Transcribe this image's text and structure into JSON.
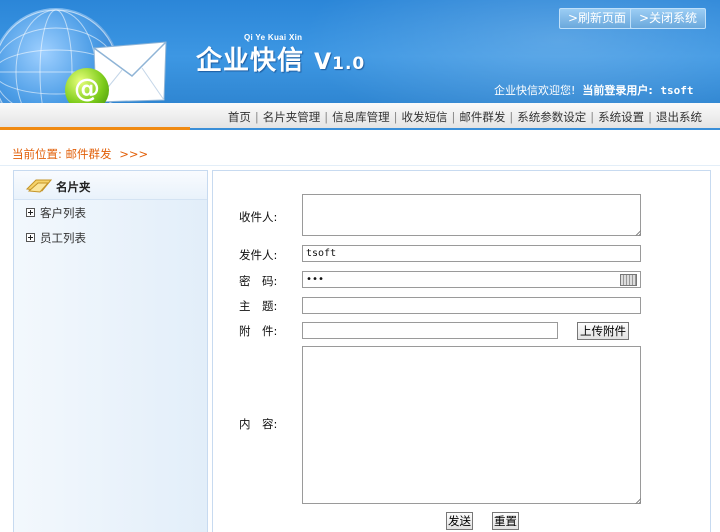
{
  "header": {
    "brand_pinyin": "Qi Ye Kuai Xin",
    "brand_name": "企业快信",
    "brand_version_major": "V",
    "brand_version_number": "1.0",
    "refresh_label": ">刷新页面",
    "close_label": ">关闭系统",
    "welcome_text": "企业快信欢迎您!",
    "current_user_label": "当前登录用户:",
    "current_user": "tsoft"
  },
  "nav": {
    "items": [
      "首页",
      "名片夹管理",
      "信息库管理",
      "收发短信",
      "邮件群发",
      "系统参数设定",
      "系统设置",
      "退出系统"
    ],
    "separator": "|"
  },
  "breadcrumb": {
    "prefix": "当前位置:",
    "current": "邮件群发",
    "suffix": ">>>"
  },
  "sidebar": {
    "title": "名片夹",
    "items": [
      {
        "label": "客户列表"
      },
      {
        "label": "员工列表"
      }
    ]
  },
  "form": {
    "to_label": "收件人:",
    "to_value": "",
    "from_label": "发件人:",
    "from_value": "tsoft",
    "password_label": "密　码:",
    "password_value": "•••",
    "subject_label": "主　题:",
    "subject_value": "",
    "attachment_label": "附　件:",
    "attachment_value": "",
    "upload_label": "上传附件",
    "content_label": "内　容:",
    "content_value": "",
    "send_label": "发送",
    "reset_label": "重置"
  },
  "colors": {
    "header_blue": "#2b86d8",
    "breadcrumb_orange": "#e2600a",
    "nav_accent_orange": "#f08a12",
    "panel_border": "#c7daf0"
  }
}
